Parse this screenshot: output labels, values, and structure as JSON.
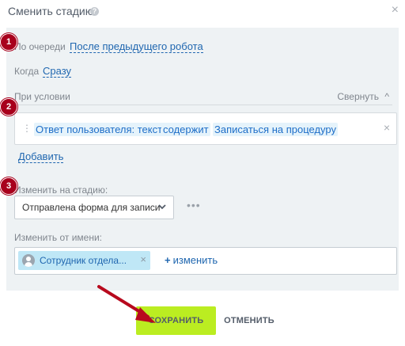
{
  "dialog": {
    "title": "Сменить стадию"
  },
  "annotations": {
    "badge_1": "1",
    "badge_2": "2",
    "badge_3": "3"
  },
  "queue": {
    "label": "По очереди",
    "value": "После предыдущего робота"
  },
  "when": {
    "label": "Когда",
    "value": "Сразу"
  },
  "condition": {
    "label": "При условии",
    "collapse_label": "Свернуть",
    "field": "Ответ пользователя: текст",
    "operator": "содержит",
    "value": "Записаться на процедуру",
    "add_label": "Добавить"
  },
  "stage": {
    "label": "Изменить на стадию:",
    "selected": "Отправлена форма для записи"
  },
  "on_behalf": {
    "label": "Изменить от имени:",
    "user": "Сотрудник отдела...",
    "change_label": "изменить"
  },
  "footer": {
    "save_label": "СОХРАНИТЬ",
    "cancel_label": "ОТМЕНИТЬ"
  },
  "colors": {
    "accent": "#bbed21",
    "link": "#2067b0",
    "badge": "#a8001c",
    "panel_bg": "#eef2f4"
  }
}
